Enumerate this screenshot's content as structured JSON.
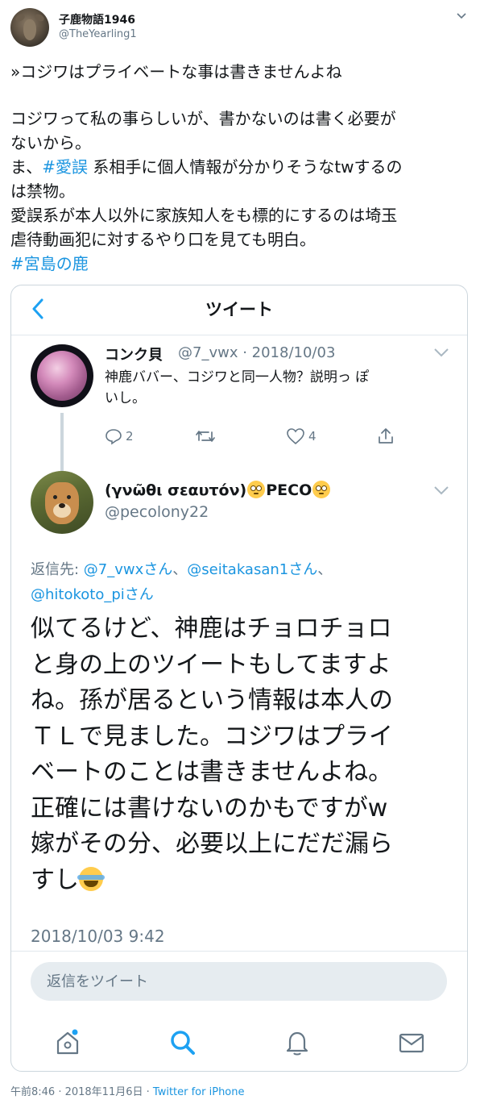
{
  "outer": {
    "author_name": "子鹿物語1946",
    "author_handle": "@TheYearling1",
    "avatar": "deer-avatar",
    "text_lines": [
      "»コジワはプライベートな事は書きませんよね",
      "",
      "コジワって私の事らしいが、書かないのは書く必要が",
      "ないから。"
    ],
    "line5_prefix": "ま、",
    "line5_hashtag": "#愛誤",
    "line5_suffix": " 系相手に個人情報が分かりそうなtwするの",
    "text_lines_2": [
      "は禁物。",
      "愛誤系が本人以外に家族知人をも標的にするのは埼玉",
      "虐待動画犯に対するやり口を見ても明白。"
    ],
    "final_hashtag": "#宮島の鹿",
    "timestamp": "午前8:46 · 2018年11月6日",
    "separator": " · ",
    "source": "Twitter for iPhone"
  },
  "screenshot": {
    "nav_title": "ツイート",
    "back_icon": "chevron-left-icon",
    "quoted": {
      "name": "コンク貝",
      "meta": "@7_vwx · 2018/10/03",
      "text_lines": [
        "神鹿ババー、コジワと同一人物？説明っ ぽ",
        "いし。"
      ],
      "replies": "2",
      "likes": "4"
    },
    "reply": {
      "name": "(γνῶθι σεαυτόν)",
      "name_suffix": "PECO",
      "handle": "@pecolony22",
      "reply_label": "返信先: ",
      "mention1": "@7_vwxさん",
      "sep1": "、",
      "mention2": "@seitakasan1さん",
      "sep2": "、",
      "mention3": "@hitokoto_piさん",
      "text_lines": [
        "似てるけど、神鹿はチョロチョロ",
        "と身の上のツイートもしてますよ",
        "ね。孫が居るという情報は本人の",
        "ＴＬで見ました。コジワはプライ",
        "ベートのことは書きませんよね。",
        "正確には書けないのかもですがw",
        "嫁がその分、必要以上にだだ漏ら"
      ],
      "last_line": "すし",
      "time": "2018/10/03 9:42"
    },
    "reply_placeholder": "返信をツイート",
    "tabs": [
      "home-icon",
      "search-icon",
      "notifications-icon",
      "messages-icon"
    ]
  },
  "colors": {
    "link_blue": "#1b95e0",
    "muted_gray": "#657786",
    "icon_blue": "#1da1f2"
  }
}
